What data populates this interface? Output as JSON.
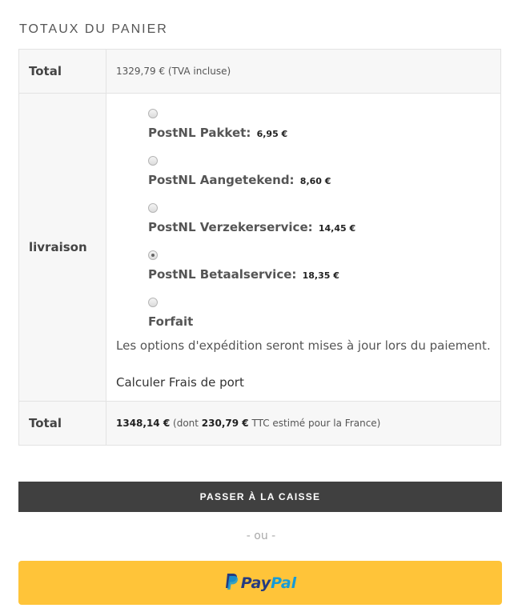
{
  "heading": "TOTAUX DU PANIER",
  "subtotal": {
    "label": "Total",
    "amount": "1329,79 €",
    "suffix": "(TVA incluse)"
  },
  "shipping": {
    "label": "livraison",
    "methods": [
      {
        "name": "PostNL Pakket:",
        "price": "6,95 €",
        "checked": false
      },
      {
        "name": "PostNL Aangetekend:",
        "price": "8,60 €",
        "checked": false
      },
      {
        "name": "PostNL Verzekerservice:",
        "price": "14,45 €",
        "checked": false
      },
      {
        "name": "PostNL Betaalservice:",
        "price": "18,35 €",
        "checked": true
      },
      {
        "name": "Forfait",
        "price": "",
        "checked": false
      }
    ],
    "note": "Les options d'expédition seront mises à jour lors du paiement.",
    "calculate_link": "Calculer Frais de port"
  },
  "total": {
    "label": "Total",
    "amount": "1348,14 €",
    "tax_prefix": "(dont",
    "tax_amount": "230,79 €",
    "tax_suffix": "TTC estimé pour la France)"
  },
  "checkout_button": "PASSER À LA CAISSE",
  "separator": "- ou -",
  "paypal": {
    "word_a": "Pay",
    "word_b": "Pal"
  },
  "colors": {
    "checkout_bg": "#404040",
    "paypal_bg": "#ffc439",
    "paypal_dark": "#253b80",
    "paypal_light": "#179bd7"
  },
  "icons": {
    "paypal": "paypal-p-icon"
  }
}
